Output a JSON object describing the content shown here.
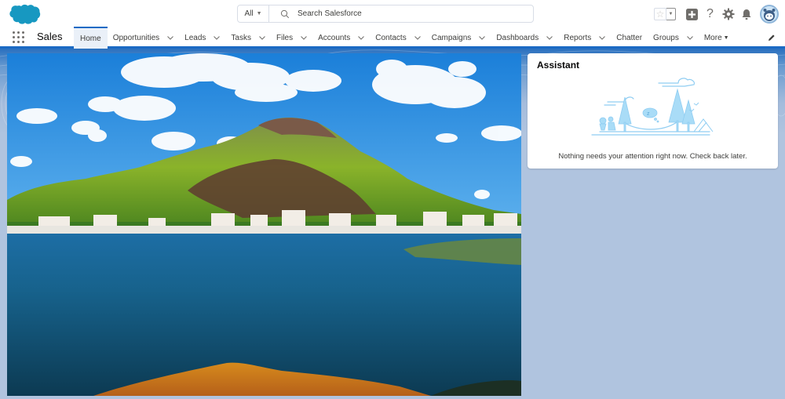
{
  "header": {
    "logo": "salesforce-cloud-logo",
    "search": {
      "scope_label": "All",
      "placeholder": "Search Salesforce",
      "value": ""
    },
    "actions": [
      {
        "name": "favorites",
        "icon": "star-icon"
      },
      {
        "name": "favorites-list",
        "icon": "caret-down-icon"
      },
      {
        "name": "global-actions",
        "icon": "plus-icon"
      },
      {
        "name": "help",
        "icon": "question-icon"
      },
      {
        "name": "setup",
        "icon": "gear-icon"
      },
      {
        "name": "notifications",
        "icon": "bell-icon"
      },
      {
        "name": "user-profile",
        "icon": "astro-avatar"
      }
    ]
  },
  "nav": {
    "app_name": "Sales",
    "items": [
      {
        "label": "Home",
        "active": true,
        "has_menu": false
      },
      {
        "label": "Opportunities",
        "active": false,
        "has_menu": true
      },
      {
        "label": "Leads",
        "active": false,
        "has_menu": true
      },
      {
        "label": "Tasks",
        "active": false,
        "has_menu": true
      },
      {
        "label": "Files",
        "active": false,
        "has_menu": true
      },
      {
        "label": "Accounts",
        "active": false,
        "has_menu": true
      },
      {
        "label": "Contacts",
        "active": false,
        "has_menu": true
      },
      {
        "label": "Campaigns",
        "active": false,
        "has_menu": true
      },
      {
        "label": "Dashboards",
        "active": false,
        "has_menu": true
      },
      {
        "label": "Reports",
        "active": false,
        "has_menu": true
      },
      {
        "label": "Chatter",
        "active": false,
        "has_menu": false
      },
      {
        "label": "Groups",
        "active": false,
        "has_menu": true
      }
    ],
    "more_label": "More",
    "edit_icon": "pencil-icon"
  },
  "main": {
    "hero_image": "mountain-lake-landscape",
    "assistant": {
      "title": "Assistant",
      "illustration": "hammock-trees-illustration",
      "message": "Nothing needs your attention right now. Check back later."
    }
  },
  "colors": {
    "brand": "#1b6ac4",
    "logo": "#1798c1",
    "page_background": "#b0c4df",
    "active_tab_bg": "#eaf0f8",
    "illustration": "#8fcdf2"
  }
}
